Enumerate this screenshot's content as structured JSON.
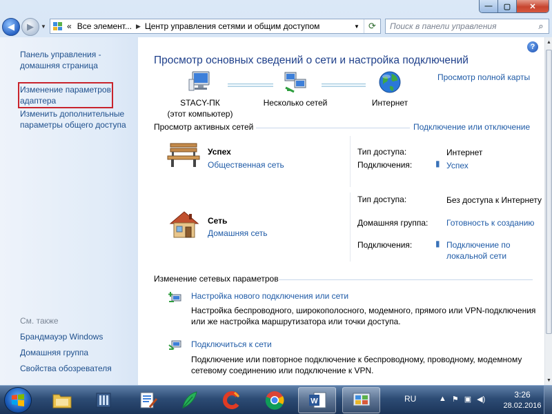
{
  "window": {
    "min_glyph": "—",
    "max_glyph": "▢",
    "close_glyph": "✕"
  },
  "address": {
    "crumbs": [
      "«",
      "Все элемент...",
      "Центр управления сетями и общим доступом"
    ],
    "search_placeholder": "Поиск в панели управления"
  },
  "sidebar": {
    "home": "Панель управления - домашняя страница",
    "change_adapter": "Изменение параметров адаптера",
    "change_sharing": "Изменить дополнительные параметры общего доступа",
    "see_also": "См. также",
    "see_also_items": [
      "Брандмауэр Windows",
      "Домашняя группа",
      "Свойства обозревателя"
    ]
  },
  "main": {
    "title": "Просмотр основных сведений о сети и настройка подключений",
    "full_map": "Просмотр полной карты",
    "map": {
      "computer_name": "STACY-ПК",
      "computer_note": "(этот компьютер)",
      "multiple": "Несколько сетей",
      "internet": "Интернет"
    },
    "active_header": "Просмотр активных сетей",
    "connect_link": "Подключение или отключение",
    "networks": [
      {
        "name": "Успех",
        "type": "Общественная сеть",
        "access_label": "Тип доступа:",
        "access_value": "Интернет",
        "conn_label": "Подключения:",
        "conn_value": "Успех"
      },
      {
        "name": "Сеть",
        "type": "Домашняя сеть",
        "access_label": "Тип доступа:",
        "access_value": "Без доступа к Интернету",
        "homegroup_label": "Домашняя группа:",
        "homegroup_value": "Готовность к созданию",
        "conn_label": "Подключения:",
        "conn_value": "Подключение по локальной сети"
      }
    ],
    "change_header": "Изменение сетевых параметров",
    "tasks": [
      {
        "title": "Настройка нового подключения или сети",
        "desc": "Настройка беспроводного, широкополосного, модемного, прямого или VPN-подключения или же настройка маршрутизатора или точки доступа."
      },
      {
        "title": "Подключиться к сети",
        "desc": "Подключение или повторное подключение к беспроводному, проводному, модемному сетевому соединению или подключение к VPN."
      }
    ]
  },
  "taskbar": {
    "language": "RU",
    "time": "3:26",
    "date": "28.02.2016",
    "apps": [
      "explorer",
      "reader",
      "word-pad",
      "feather",
      "ccleaner",
      "chrome",
      "word",
      "control-panel"
    ]
  },
  "colors": {
    "link": "#1e5aa6",
    "title": "#1e3f8a",
    "highlight_box": "#c8232c"
  }
}
